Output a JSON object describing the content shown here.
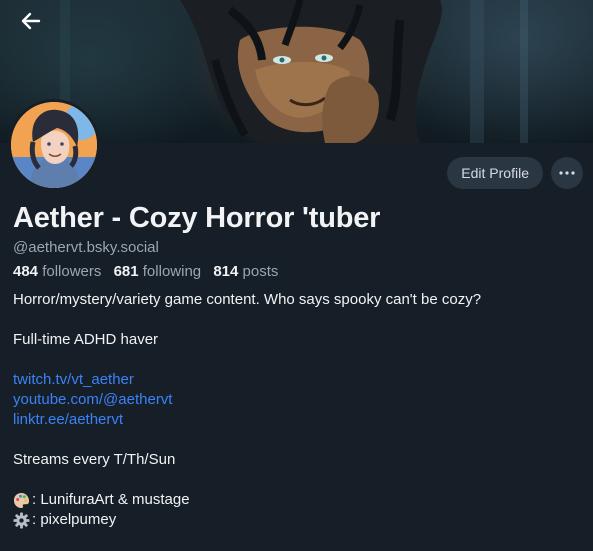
{
  "header": {
    "back_icon": "arrow-left-icon"
  },
  "profile": {
    "display_name": "Aether - Cozy Horror 'tuber",
    "handle": "@aethervt.bsky.social",
    "followers_count": "484",
    "followers_label": "followers",
    "following_count": "681",
    "following_label": "following",
    "posts_count": "814",
    "posts_label": "posts"
  },
  "actions": {
    "edit_label": "Edit Profile",
    "more_icon": "ellipsis-icon"
  },
  "bio": {
    "line1": "Horror/mystery/variety game content.  Who says spooky can't be cozy?",
    "line2": "Full-time ADHD haver",
    "links": [
      "twitch.tv/vt_aether",
      "youtube.com/@aethervt",
      "linktr.ee/aethervt"
    ],
    "line3": "Streams every T/Th/Sun",
    "art_credit": ": LunifuraArt & mustage",
    "rig_credit": ": pixelpumey",
    "art_emoji": "palette-icon",
    "rig_emoji": "gear-icon"
  },
  "colors": {
    "background": "#161e27",
    "link": "#3b82f6",
    "muted": "#9aa6b4",
    "button_bg": "#2b3643"
  }
}
